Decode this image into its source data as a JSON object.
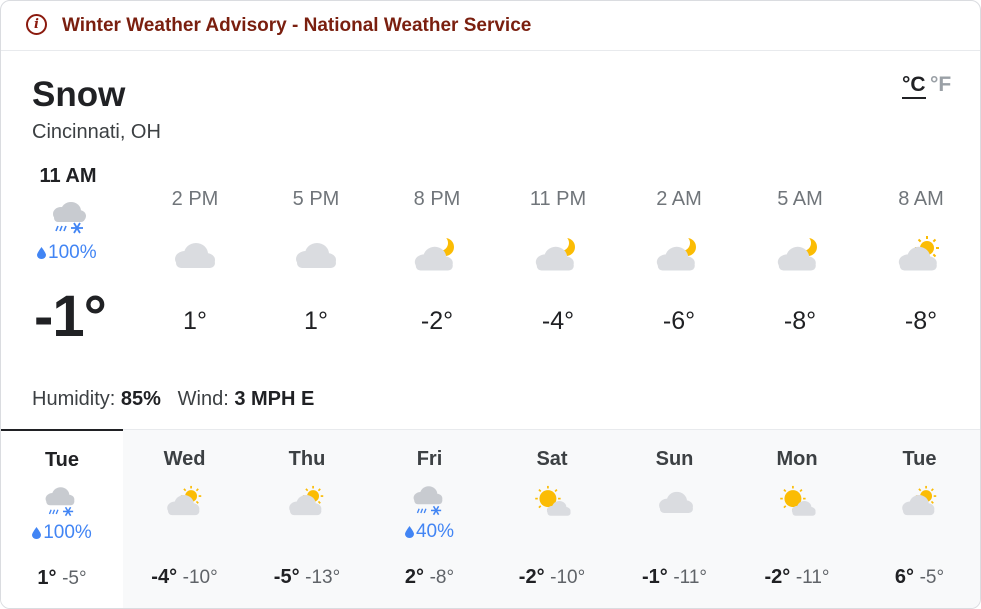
{
  "advisory": {
    "text": "Winter Weather Advisory - National Weather Service",
    "color": "#7a1f0f",
    "icon": "info-circle-icon"
  },
  "current": {
    "condition": "Snow",
    "location": "Cincinnati, OH",
    "time": "11 AM",
    "icon": "snow-cloud-icon",
    "precip": "100%",
    "temp": "-1°",
    "humidity_label": "Humidity:",
    "humidity": "85%",
    "wind_label": "Wind:",
    "wind": "3 MPH E"
  },
  "units": {
    "celsius": "°C",
    "fahrenheit": "°F",
    "selected": "celsius"
  },
  "hourly": [
    {
      "time": "2 PM",
      "temp": "1°",
      "icon": "cloud-icon"
    },
    {
      "time": "5 PM",
      "temp": "1°",
      "icon": "cloud-icon"
    },
    {
      "time": "8 PM",
      "temp": "-2°",
      "icon": "moon-cloud-icon"
    },
    {
      "time": "11 PM",
      "temp": "-4°",
      "icon": "moon-cloud-icon"
    },
    {
      "time": "2 AM",
      "temp": "-6°",
      "icon": "moon-cloud-icon"
    },
    {
      "time": "5 AM",
      "temp": "-8°",
      "icon": "moon-cloud-icon"
    },
    {
      "time": "8 AM",
      "temp": "-8°",
      "icon": "sun-cloud-icon"
    }
  ],
  "daily": [
    {
      "day": "Tue",
      "icon": "snow-cloud-icon",
      "precip": "100%",
      "high": "1°",
      "low": "-5°",
      "selected": true
    },
    {
      "day": "Wed",
      "icon": "sun-cloud-icon",
      "precip": "",
      "high": "-4°",
      "low": "-10°"
    },
    {
      "day": "Thu",
      "icon": "sun-cloud-icon",
      "precip": "",
      "high": "-5°",
      "low": "-13°"
    },
    {
      "day": "Fri",
      "icon": "snow-cloud-icon",
      "precip": "40%",
      "high": "2°",
      "low": "-8°"
    },
    {
      "day": "Sat",
      "icon": "sun-small-cloud-icon",
      "precip": "",
      "high": "-2°",
      "low": "-10°"
    },
    {
      "day": "Sun",
      "icon": "cloud-icon",
      "precip": "",
      "high": "-1°",
      "low": "-11°"
    },
    {
      "day": "Mon",
      "icon": "sun-small-cloud-icon",
      "precip": "",
      "high": "-2°",
      "low": "-11°"
    },
    {
      "day": "Tue",
      "icon": "sun-cloud-icon",
      "precip": "",
      "high": "6°",
      "low": "-5°"
    }
  ],
  "colors": {
    "precip": "#4285f4",
    "sun": "#fbbc04",
    "cloud": "#dadce0"
  }
}
